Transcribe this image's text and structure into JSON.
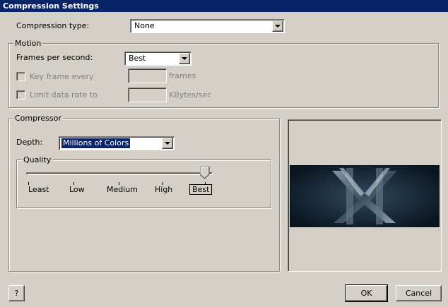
{
  "window": {
    "title": "Compression Settings"
  },
  "compression": {
    "label": "Compression type:",
    "value": "None"
  },
  "motion": {
    "group_label": "Motion",
    "fps_label": "Frames per second:",
    "fps_value": "Best",
    "keyframe_label": "Key frame every",
    "keyframe_value": "",
    "keyframe_unit": "frames",
    "limit_label": "Limit data rate to",
    "limit_value": "",
    "limit_unit": "KBytes/sec"
  },
  "compressor": {
    "group_label": "Compressor",
    "depth_label": "Depth:",
    "depth_value": "Millions of Colors",
    "quality": {
      "group_label": "Quality",
      "levels": [
        "Least",
        "Low",
        "Medium",
        "High",
        "Best"
      ],
      "selected": "Best",
      "level_fraction": 1.0
    }
  },
  "buttons": {
    "help": "?",
    "ok": "OK",
    "cancel": "Cancel"
  },
  "icons": {
    "preview": "movie-preview-image",
    "dropdown": "chevron-down-icon",
    "slider": "slider-thumb-icon"
  }
}
